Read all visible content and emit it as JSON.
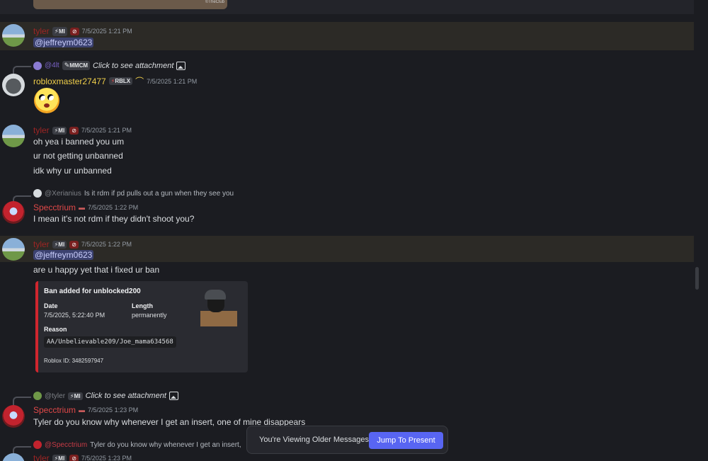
{
  "top_attachment": {
    "caption": "©TheClub"
  },
  "messages": [
    {
      "author": "tyler",
      "badge": "MI",
      "time": "7/5/2025 1:21 PM",
      "mention": "@jeffreym0623"
    },
    {
      "reply": {
        "user": "@4lt",
        "badge": "MMCM",
        "text": "Click to see attachment"
      },
      "author": "robloxmaster27477",
      "badge": "RBLX",
      "time": "7/5/2025 1:21 PM"
    },
    {
      "author": "tyler",
      "badge": "MI",
      "time": "7/5/2025 1:21 PM",
      "lines": [
        "oh yea i banned you um",
        "ur not getting unbanned",
        "idk why ur unbanned"
      ]
    },
    {
      "reply": {
        "user": "@Xerianius",
        "text": "Is it rdm if pd pulls out a gun when they see you"
      },
      "author": "Specctrium",
      "time": "7/5/2025 1:22 PM",
      "lines": [
        "I mean it's not rdm if they didn't shoot you?"
      ]
    },
    {
      "author": "tyler",
      "badge": "MI",
      "time": "7/5/2025 1:22 PM",
      "mention": "@jeffreym0623",
      "lines": [
        "are u happy yet that i fixed ur ban"
      ]
    },
    {
      "reply": {
        "user": "@tyler",
        "badge": "MI",
        "text": "Click to see attachment"
      },
      "author": "Specctrium",
      "time": "7/5/2025 1:23 PM",
      "lines": [
        "Tyler do you know why whenever I get an insert, one of mine disappears"
      ]
    },
    {
      "reply": {
        "user": "@Specctrium",
        "text": "Tyler do you know why whenever I get an insert,"
      },
      "author": "tyler",
      "badge": "MI",
      "time": "7/5/2025 1:23 PM"
    }
  ],
  "embed": {
    "title": "Ban added for unblocked200",
    "date_label": "Date",
    "date_value": "7/5/2025, 5:22:40 PM",
    "length_label": "Length",
    "length_value": "permanently",
    "reason_label": "Reason",
    "reason_value": "AA/Unbelievable209/Joe_mama634568",
    "footer": "Roblox ID: 3482597947",
    "accent": "#d0262e"
  },
  "jump": {
    "notice": "You're Viewing Older Messages",
    "button": "Jump To Present",
    "button_color": "#5865f2"
  }
}
